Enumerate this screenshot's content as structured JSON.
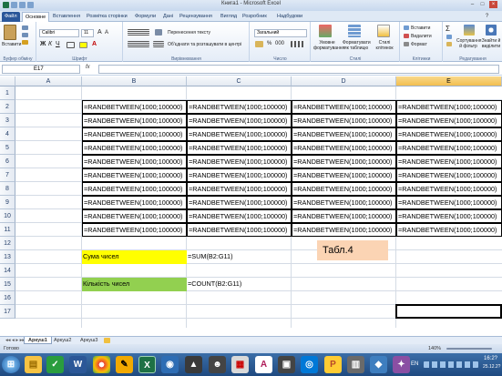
{
  "window": {
    "title": "Книга1 - Microsoft Excel"
  },
  "tabs": [
    "Файл",
    "Основне",
    "Вставлення",
    "Розмітка сторінки",
    "Формули",
    "Дані",
    "Рецензування",
    "Вигляд",
    "Розробник",
    "Надбудови"
  ],
  "ribbon": {
    "paste": "Вставити",
    "font_name": "Calibri",
    "font_size": "11",
    "wrap_text": "Перенесення тексту",
    "merge_center": "Об'єднати та розташувати в центрі",
    "number_format": "Загальний",
    "conditional": "Умовне форматування",
    "format_table": "Форматувати як таблицю",
    "cell_styles": "Стилі клітинок",
    "insert": "Вставити",
    "delete": "Видалити",
    "format": "Формат",
    "sort_filter": "Сортування й фільтр",
    "find_select": "Знайти й виділити",
    "groups": {
      "clipboard": "Буфер обміну",
      "font": "Шрифт",
      "alignment": "Вирівнювання",
      "number": "Число",
      "styles": "Стилі",
      "cells": "Клітинки",
      "editing": "Редагування"
    }
  },
  "formula_bar": {
    "name_box": "E17",
    "fx": "fx",
    "value": ""
  },
  "grid": {
    "columns": [
      "A",
      "B",
      "C",
      "D",
      "E"
    ],
    "rows": [
      "1",
      "2",
      "3",
      "4",
      "5",
      "6",
      "7",
      "8",
      "9",
      "10",
      "11",
      "12",
      "13",
      "14",
      "15",
      "16",
      "17"
    ],
    "formula_rand": "=RANDBETWEEN(1000;100000)",
    "sum_label": "Сума чисел",
    "sum_formula": "=SUM(B2:G11)",
    "count_label": "Кількість чисел",
    "count_formula": "=COUNT(B2:G11)",
    "table_label": "Табл.4",
    "colors": {
      "sum_fill": "#ffff00",
      "count_fill": "#92d050",
      "table_fill": "#fbd4b4",
      "selected_header": "#f5c55a"
    }
  },
  "sheets": [
    "Аркуш1",
    "Аркуш2",
    "Аркуш3"
  ],
  "status": {
    "ready": "Готово",
    "zoom": "140%"
  },
  "taskbar": {
    "lang": "EN",
    "time": "16:2?",
    "date": "25.12.2?"
  }
}
